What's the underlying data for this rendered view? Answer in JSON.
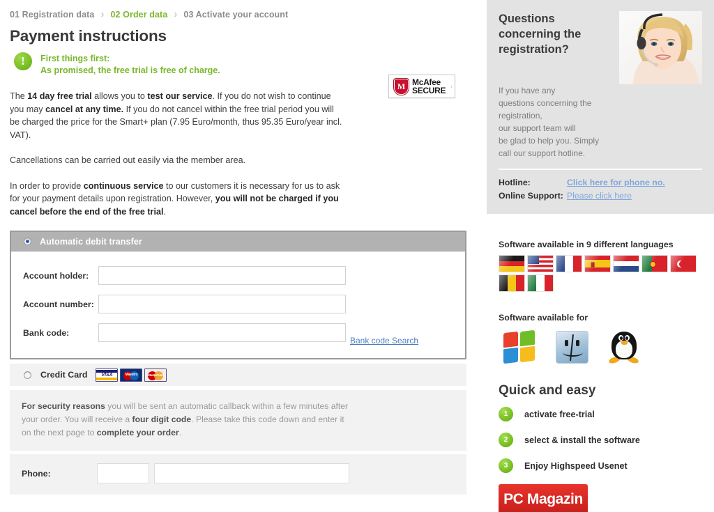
{
  "breadcrumb": {
    "steps": [
      {
        "label": "01 Registration data",
        "active": false
      },
      {
        "label": "02 Order data",
        "active": true
      },
      {
        "label": "03 Activate your account",
        "active": false
      }
    ],
    "separator": "›",
    "active_color": "#79b729"
  },
  "page_title": "Payment instructions",
  "alert": {
    "icon": "exclamation-circle-icon",
    "glyph": "!",
    "line1": "First things first:",
    "line2": "As promised, the free trial is free of charge.",
    "color": "#79b729"
  },
  "trust_badge": {
    "name": "mcafee-secure-badge",
    "mark": "M",
    "line1": "McAfee",
    "line2": "SECURE",
    "arrow": "›",
    "shield_color": "#c8102e"
  },
  "copy": {
    "p1_a": "The ",
    "p1_b1": "14 day free trial",
    "p1_c": " allows you to ",
    "p1_b2": "test our service",
    "p1_d": ". If you do not wish to continue you may ",
    "p1_b3": "cancel at any time.",
    "p1_e": " If you do not cancel within the free trial period you will be charged the price for the Smart+ plan (7.95 Euro/month, thus 95.35 Euro/year incl. VAT).",
    "p2": "Cancellations can be carried out easily via the member area.",
    "p3_a": "In order to provide ",
    "p3_b1": "continuous service",
    "p3_c": " to our customers it is necessary for us to ask for your payment details upon registration. However, ",
    "p3_b2": "you will not be charged if you cancel before the end of the free trial",
    "p3_d": "."
  },
  "payment": {
    "debit": {
      "label": "Automatic debit transfer",
      "selected": true,
      "fields": [
        {
          "label": "Account holder:",
          "value": "",
          "name": "account-holder-input"
        },
        {
          "label": "Account number:",
          "value": "",
          "name": "account-number-input"
        },
        {
          "label": "Bank code:",
          "value": "",
          "name": "bank-code-input"
        }
      ],
      "bank_code_search": "Bank code Search"
    },
    "credit_card": {
      "label": "Credit Card",
      "selected": false,
      "logos": [
        {
          "name": "visa-logo",
          "text": "VISA"
        },
        {
          "name": "maestro-logo",
          "text": "Maestro"
        },
        {
          "name": "mastercard-logo",
          "text": "MasterCard"
        }
      ]
    },
    "security_notice": {
      "b1": "For security reasons",
      "t1": " you will be sent an automatic callback within a few minutes after your order. You will receive a ",
      "b2": "four digit code",
      "t2": ". Please take this code down and enter it on the next page to ",
      "b3": "complete your order",
      "t3": "."
    },
    "phone": {
      "label": "Phone:",
      "area_code_value": "",
      "number_value": ""
    }
  },
  "sidebar": {
    "support": {
      "title": "Questions concerning the registration?",
      "body": "If you have any questions concerning the registration,\nour support team will be glad to help you. Simply call our support hotline.",
      "body_lines": [
        "If you have any",
        "questions concerning the",
        "registration,",
        "our support team will",
        "be glad to help you. Simply",
        "call our support hotline."
      ],
      "photo": "support-agent-headset-photo",
      "rows": [
        {
          "key": "Hotline:",
          "value": "Click here for phone no."
        },
        {
          "key": "Online Support:",
          "value": "Please click here"
        }
      ],
      "link_color": "#7fa8dd",
      "background": "#e3e3e3"
    },
    "languages": {
      "heading": "Software available in 9 different languages",
      "count": 9,
      "flags": [
        "germany-flag",
        "usa-flag",
        "france-flag",
        "spain-flag",
        "netherlands-flag",
        "portugal-flag",
        "turkey-flag",
        "belgium-flag",
        "italy-flag"
      ]
    },
    "platforms": {
      "heading": "Software available for",
      "icons": [
        "windows-icon",
        "mac-finder-icon",
        "linux-tux-icon"
      ]
    },
    "quick": {
      "title": "Quick and easy",
      "steps": [
        {
          "num": "1",
          "label": "activate free-trial"
        },
        {
          "num": "2",
          "label": "select & install the software"
        },
        {
          "num": "3",
          "label": "Enjoy Highspeed Usenet"
        }
      ],
      "accent": "#7dc225"
    },
    "award_badge": {
      "name": "pc-magazin-badge",
      "label": "PC Magazin",
      "color": "#c9201c"
    }
  }
}
